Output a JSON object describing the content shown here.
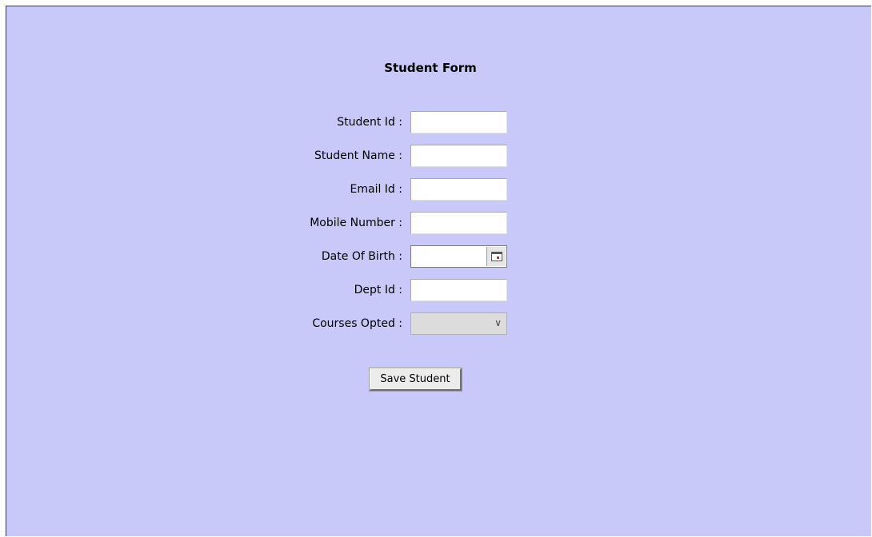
{
  "form": {
    "title": "Student Form",
    "fields": [
      {
        "label": "Student Id :",
        "value": ""
      },
      {
        "label": "Student Name :",
        "value": ""
      },
      {
        "label": "Email Id :",
        "value": ""
      },
      {
        "label": "Mobile Number :",
        "value": ""
      },
      {
        "label": "Date Of Birth :",
        "value": ""
      },
      {
        "label": "Dept Id :",
        "value": ""
      },
      {
        "label": "Courses Opted :",
        "value": ""
      }
    ],
    "save_label": "Save Student"
  },
  "icons": {
    "calendar": "calendar-icon",
    "dropdown": "chevron-down-icon"
  },
  "colors": {
    "background": "#c8c8f9"
  }
}
